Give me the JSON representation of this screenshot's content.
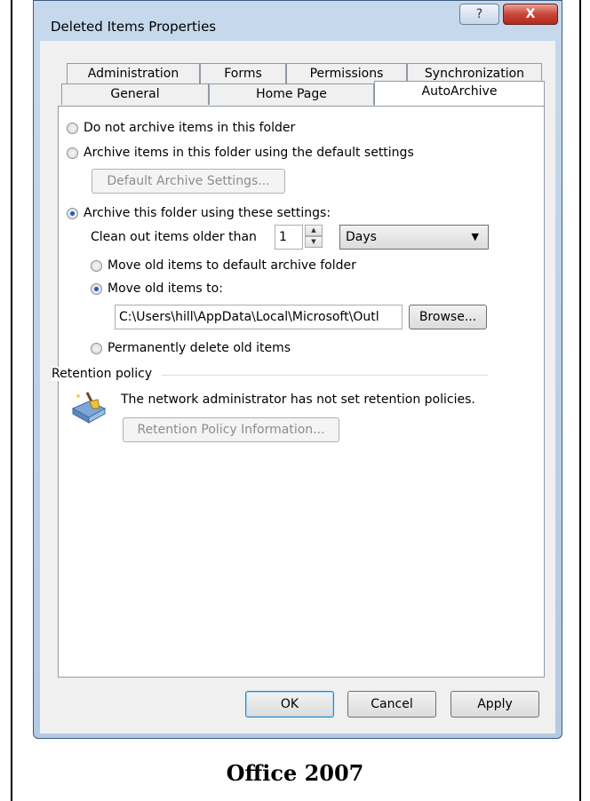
{
  "window": {
    "title": "Deleted Items Properties",
    "help_glyph": "?",
    "close_glyph": "X"
  },
  "tabs": {
    "row1": [
      "Administration",
      "Forms",
      "Permissions",
      "Synchronization"
    ],
    "row2": [
      "General",
      "Home Page",
      "AutoArchive"
    ],
    "active": "AutoArchive"
  },
  "autoarchive": {
    "opt_no_archive": "Do not archive items in this folder",
    "opt_default": "Archive items in this folder using the default settings",
    "default_settings_button": "Default Archive Settings...",
    "opt_custom": "Archive this folder using these settings:",
    "clean_out_label": "Clean out items older than",
    "clean_out_value": "1",
    "unit_selected": "Days",
    "opt_move_default": "Move old items to default archive folder",
    "opt_move_to": "Move old items to:",
    "path_value": "C:\\Users\\hill\\AppData\\Local\\Microsoft\\Outl",
    "browse_button": "Browse...",
    "opt_delete": "Permanently delete old items",
    "selected": [
      "opt_custom",
      "opt_move_to"
    ]
  },
  "retention": {
    "group_label": "Retention policy",
    "message": "The network administrator has not set retention policies.",
    "info_button": "Retention Policy Information...",
    "icon": "broom-folder-icon"
  },
  "footer_buttons": {
    "ok": "OK",
    "cancel": "Cancel",
    "apply": "Apply"
  },
  "caption": "Office 2007"
}
